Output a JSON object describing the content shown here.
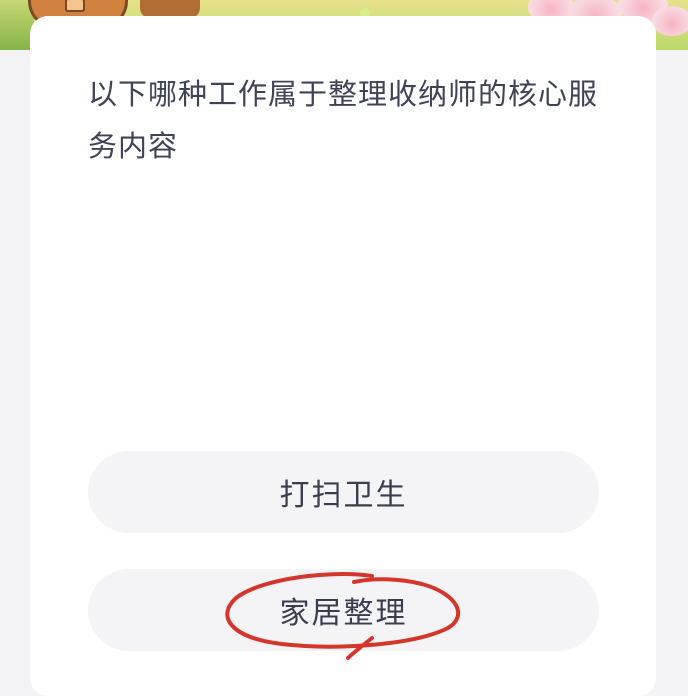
{
  "quiz": {
    "question": "以下哪种工作属于整理收纳师的核心服务内容",
    "options": [
      {
        "label": "打扫卫生",
        "selected": false
      },
      {
        "label": "家居整理",
        "selected": true
      }
    ]
  },
  "annotation": {
    "type": "hand-drawn-circle",
    "target": "option-2",
    "color": "#d5362b"
  }
}
